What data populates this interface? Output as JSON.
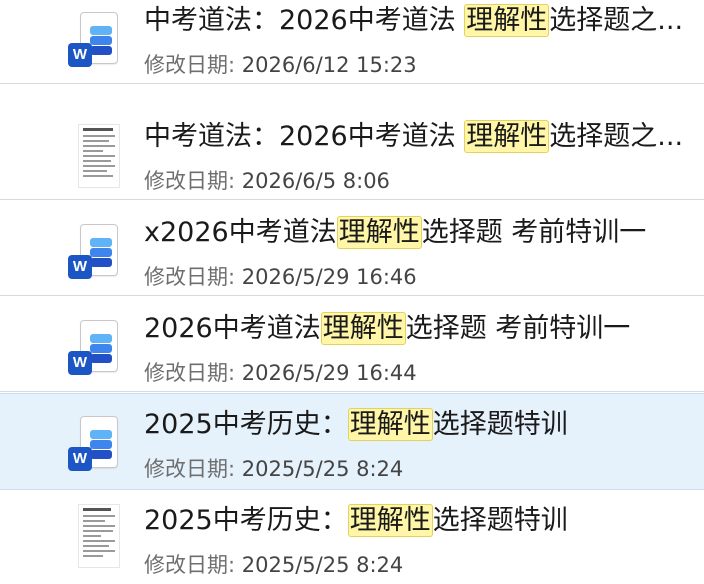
{
  "date_label": "修改日期:",
  "files": [
    {
      "icon": "word",
      "pre": "中考道法：2026中考道法 ",
      "hl": "理解性",
      "post": "选择题之...",
      "date": "2026/6/12 15:23",
      "selected": false
    },
    {
      "icon": "thumb",
      "pre": "中考道法：2026中考道法 ",
      "hl": "理解性",
      "post": "选择题之...",
      "date": "2026/6/5 8:06",
      "selected": false
    },
    {
      "icon": "word",
      "pre": "x2026中考道法",
      "hl": "理解性",
      "post": "选择题  考前特训一",
      "date": "2026/5/29 16:46",
      "selected": false
    },
    {
      "icon": "word",
      "pre": "2026中考道法",
      "hl": "理解性",
      "post": "选择题  考前特训一",
      "date": "2026/5/29 16:44",
      "selected": false
    },
    {
      "icon": "word",
      "pre": "2025中考历史：",
      "hl": "理解性",
      "post": "选择题特训",
      "date": "2025/5/25 8:24",
      "selected": true
    },
    {
      "icon": "thumb",
      "pre": "2025中考历史：",
      "hl": "理解性",
      "post": "选择题特训",
      "date": "2025/5/25 8:24",
      "selected": false
    }
  ],
  "word_badge": "W",
  "colors": {
    "highlight": "#fff6a8",
    "selected_bg": "#e5f1fb",
    "word_blue": "#1c55c4"
  }
}
